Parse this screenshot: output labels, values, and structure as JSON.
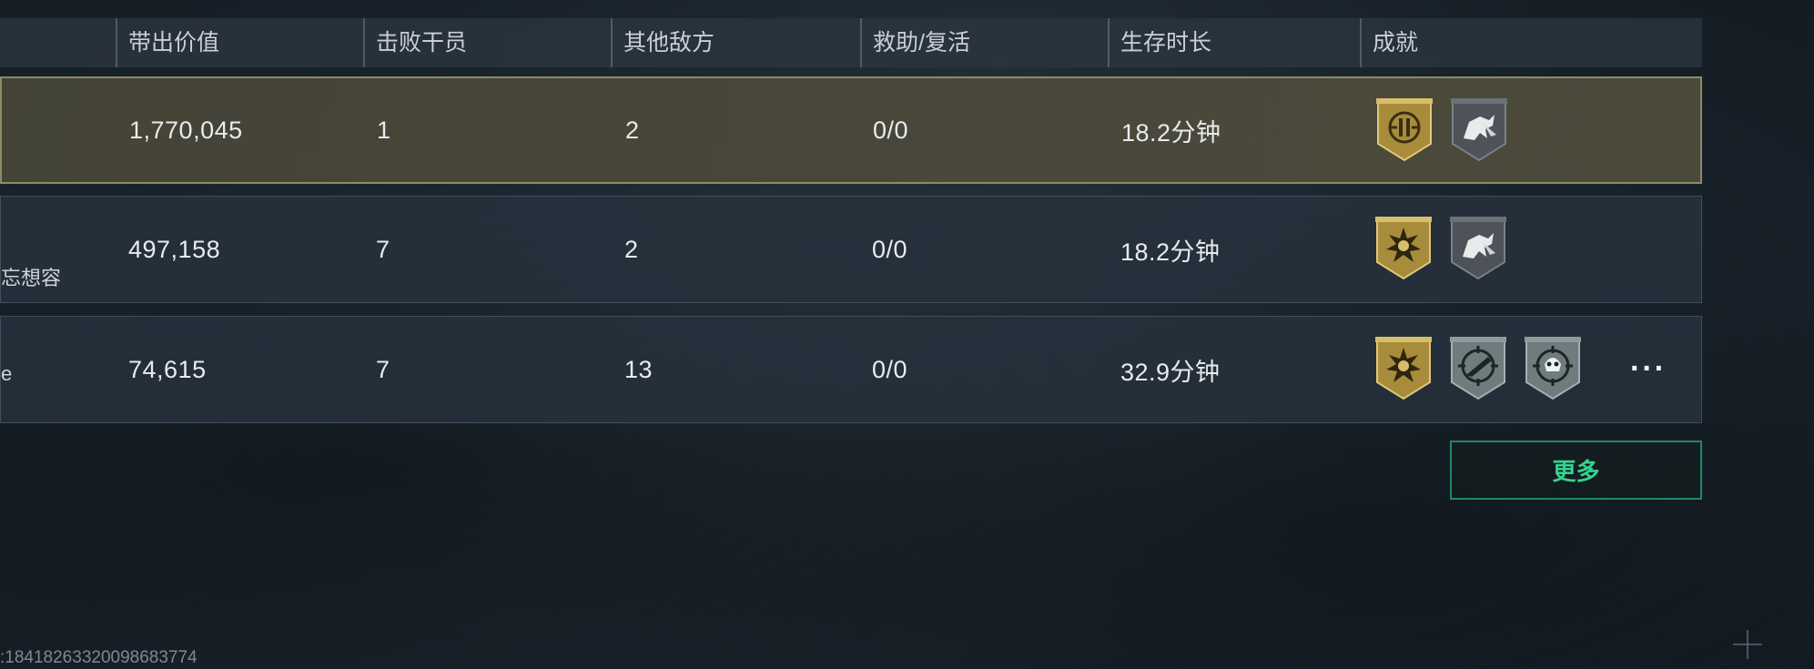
{
  "headers": [
    {
      "key": "value",
      "label": "带出价值"
    },
    {
      "key": "kills",
      "label": "击败干员"
    },
    {
      "key": "others",
      "label": "其他敌方"
    },
    {
      "key": "assist",
      "label": "救助/复活"
    },
    {
      "key": "survival",
      "label": "生存时长"
    },
    {
      "key": "achievements",
      "label": "成就"
    }
  ],
  "rows": [
    {
      "name": "",
      "value": "1,770,045",
      "kills": "1",
      "others": "2",
      "assist": "0/0",
      "survival": "18.2分钟",
      "badges": [
        "gold-emblem-badge-icon",
        "gray-horse-badge-icon"
      ]
    },
    {
      "name": "忘想容",
      "value": "497,158",
      "kills": "7",
      "others": "2",
      "assist": "0/0",
      "survival": "18.2分钟",
      "badges": [
        "gold-burst-badge-icon",
        "gray-horse-badge-icon"
      ]
    },
    {
      "name": "e",
      "value": "74,615",
      "kills": "7",
      "others": "13",
      "assist": "0/0",
      "survival": "32.9分钟",
      "badges": [
        "gold-burst-badge-icon",
        "teal-rifle-target-badge-icon",
        "teal-skull-target-badge-icon"
      ]
    }
  ],
  "overflow_label": "···",
  "more_button_label": "更多",
  "footer_id": ":18418263320098683774",
  "colors": {
    "accent_green": "#37d28f",
    "gold": "#bfa24a",
    "teal_gray": "#7d8a8c"
  }
}
